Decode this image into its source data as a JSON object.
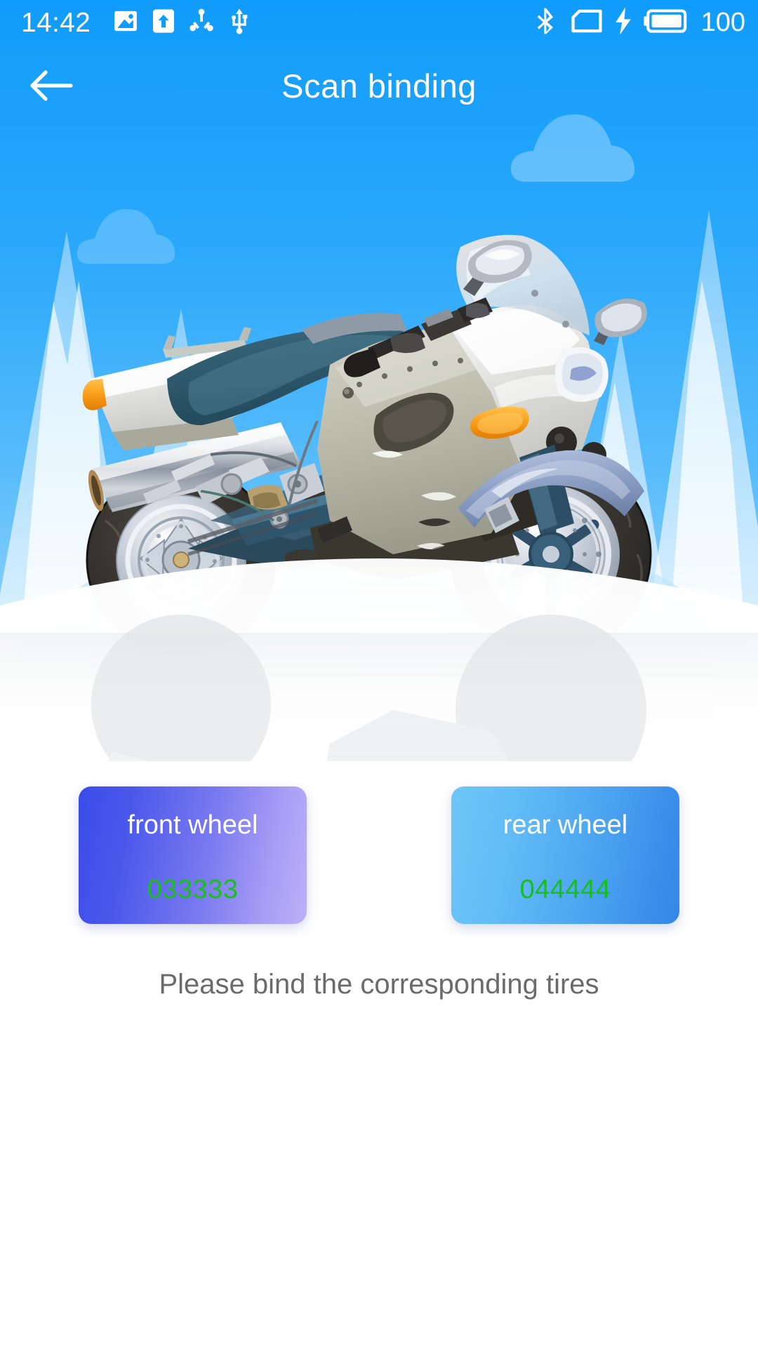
{
  "theme": {
    "primary_blue": "#109cfb",
    "sky_top": "#109cfb",
    "sky_bottom": "#c6e7fd",
    "code_green": "#16c016",
    "hint_gray": "#6b6b6b",
    "card_front_from": "#3b4be8",
    "card_front_to": "#bdb0f7",
    "card_rear_from": "#6ec6f7",
    "card_rear_to": "#3587e8"
  },
  "status_bar": {
    "time": "14:42",
    "battery_level": "100",
    "left_icons": [
      "screenshot-image-icon",
      "upload-arrow-icon",
      "share-nodes-icon",
      "usb-icon"
    ],
    "right_icons": [
      "bluetooth-icon",
      "sim-card-icon",
      "charging-bolt-icon",
      "battery-icon"
    ]
  },
  "app_bar": {
    "back_icon": "arrow-left-icon",
    "title": "Scan binding"
  },
  "hero": {
    "illustration": "motorcycle-illustration",
    "alt_label": "Motorcycle on snowy mountain background with reflection"
  },
  "wheel_cards": [
    {
      "id": "front-wheel",
      "label": "front wheel",
      "code": "033333"
    },
    {
      "id": "rear-wheel",
      "label": "rear wheel",
      "code": "044444"
    }
  ],
  "hint": {
    "text": "Please bind the corresponding tires"
  }
}
